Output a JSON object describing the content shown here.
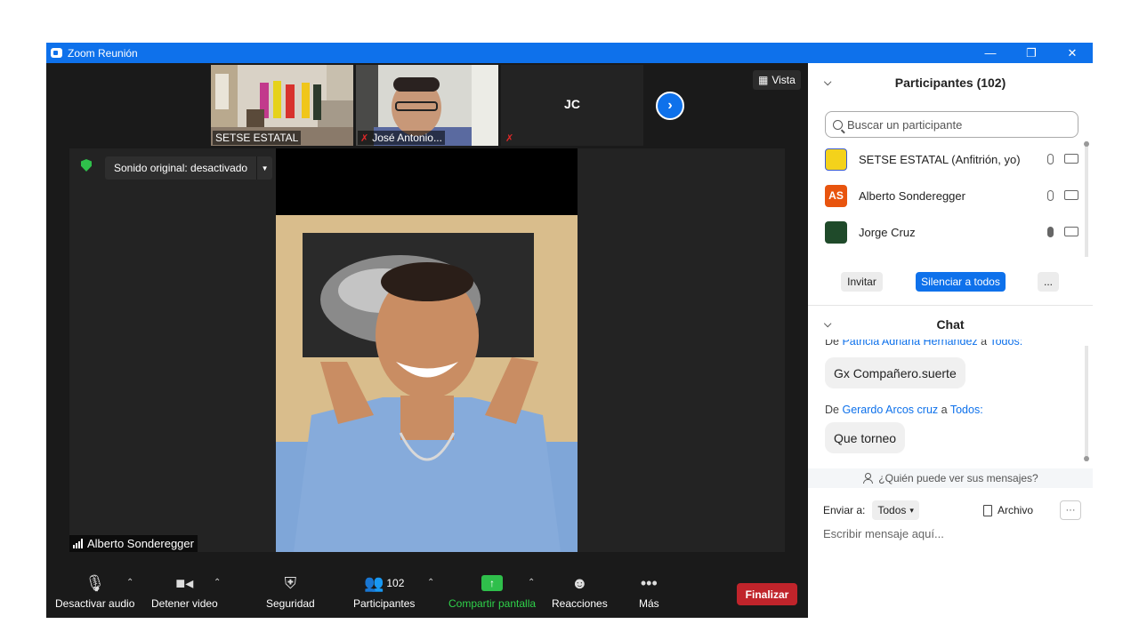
{
  "window": {
    "title": "Zoom Reunión",
    "controls": [
      "—",
      "❐",
      "✕"
    ]
  },
  "thumbnails": [
    {
      "name": "SETSE ESTATAL"
    },
    {
      "name": "José Antonio..."
    },
    {
      "initials": "JC"
    }
  ],
  "view_button": {
    "label": "Vista"
  },
  "original_sound": {
    "label": "Sonido original: desactivado"
  },
  "active_speaker": {
    "name": "Alberto Sonderegger"
  },
  "toolbar": {
    "mute_label": "Desactivar audio",
    "video_label": "Detener video",
    "security_label": "Seguridad",
    "participants_label": "Participantes",
    "participants_count": "102",
    "share_label": "Compartir pantalla",
    "reactions_label": "Reacciones",
    "more_label": "Más",
    "end_label": "Finalizar"
  },
  "participants_panel": {
    "title": "Participantes (102)",
    "search_placeholder": "Buscar un participante",
    "items": [
      {
        "name": "SETSE ESTATAL (Anfitrión, yo)",
        "avatar": "",
        "avatar_color": "#f4d21b"
      },
      {
        "name": "Alberto Sonderegger",
        "avatar": "AS",
        "avatar_color": "#e8540e"
      },
      {
        "name": "Jorge Cruz",
        "avatar": "",
        "avatar_color": "#1f4a2a"
      }
    ],
    "invite_label": "Invitar",
    "mute_all_label": "Silenciar a todos",
    "more_label": "..."
  },
  "chat_panel": {
    "title": "Chat",
    "messages": [
      {
        "prefix": "De",
        "sender": "Patricia Adriana Hernández",
        "mid": "a",
        "to": "Todos:",
        "text": "Gx Compañero.suerte"
      },
      {
        "prefix": "De",
        "sender": "Gerardo Arcos cruz",
        "mid": "a",
        "to": "Todos:",
        "text": "Que torneo"
      }
    ],
    "who_can_see": "¿Quién puede ver sus mensajes?",
    "send_to_label": "Enviar a:",
    "send_to_value": "Todos",
    "file_label": "Archivo",
    "more_label": "···",
    "input_placeholder": "Escribir mensaje aquí..."
  }
}
